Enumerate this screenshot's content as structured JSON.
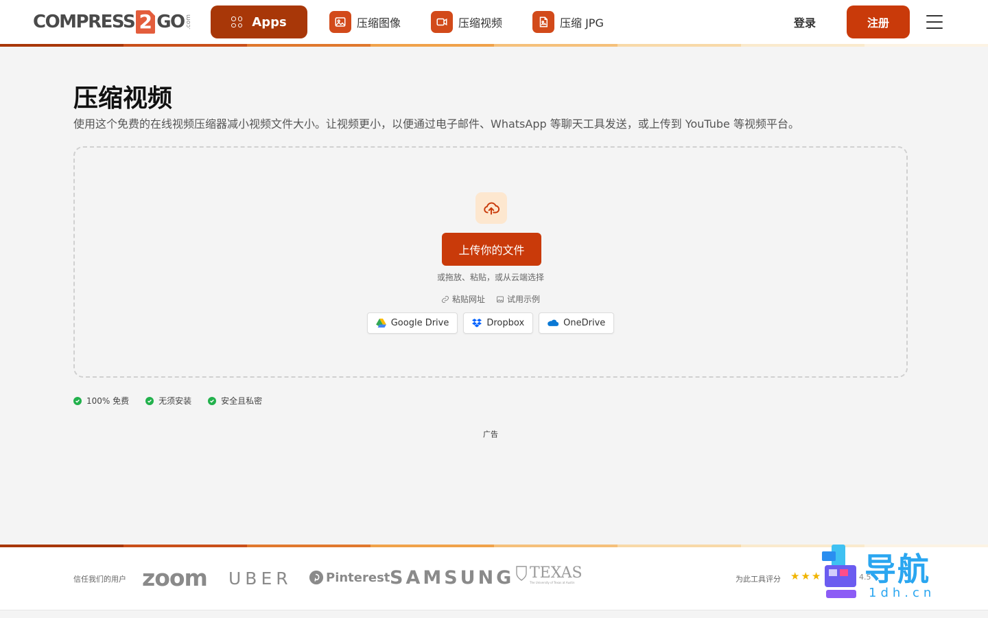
{
  "colors": {
    "primary": "#c93a0a",
    "apps_bg": "#a83708",
    "accent_light": "#fde7cf",
    "check_green": "#22b14c",
    "stripe": [
      "#a83708",
      "#c94f1a",
      "#e0782e",
      "#f0a24a",
      "#f5c07a",
      "#f8d9a8",
      "#faeacd",
      "#fcf3e4"
    ]
  },
  "header": {
    "logo": {
      "left": "COMPRESS",
      "digit": "2",
      "right": "GO",
      "suffix": ".com"
    },
    "apps_label": "Apps",
    "nav": [
      {
        "label": "压缩图像",
        "icon": "image-icon"
      },
      {
        "label": "压缩视频",
        "icon": "video-icon"
      },
      {
        "label": "压缩 JPG",
        "icon": "jpg-file-icon"
      }
    ],
    "login_label": "登录",
    "register_label": "注册",
    "menu_icon": "hamburger-icon"
  },
  "main": {
    "title": "压缩视频",
    "description": "使用这个免费的在线视频压缩器减小视频文件大小。让视频更小，以便通过电子邮件、WhatsApp 等聊天工具发送，或上传到 YouTube 等视频平台。",
    "upload": {
      "icon": "cloud-upload-icon",
      "button_label": "上传你的文件",
      "hint": "或拖放、粘贴，或从云端选择",
      "paste_url_label": "粘贴网址",
      "try_example_label": "试用示例",
      "cloud_sources": [
        {
          "label": "Google Drive",
          "icon": "google-drive-icon"
        },
        {
          "label": "Dropbox",
          "icon": "dropbox-icon"
        },
        {
          "label": "OneDrive",
          "icon": "onedrive-icon"
        }
      ]
    },
    "features": [
      "100% 免费",
      "无须安装",
      "安全且私密"
    ],
    "ad_label": "广告"
  },
  "footer": {
    "trusted_label": "信任我们的用户",
    "brands": [
      "zoom",
      "UBER",
      "Pinterest",
      "SAMSUNG",
      "TEXAS"
    ],
    "texas_sub": "The University of Texas at Austin",
    "rating_label": "为此工具评分",
    "stars": "★★★",
    "rating_value": "4.5",
    "rating_suffix": "2"
  },
  "watermark": {
    "text": "导航",
    "sub": "1dh.cn"
  }
}
